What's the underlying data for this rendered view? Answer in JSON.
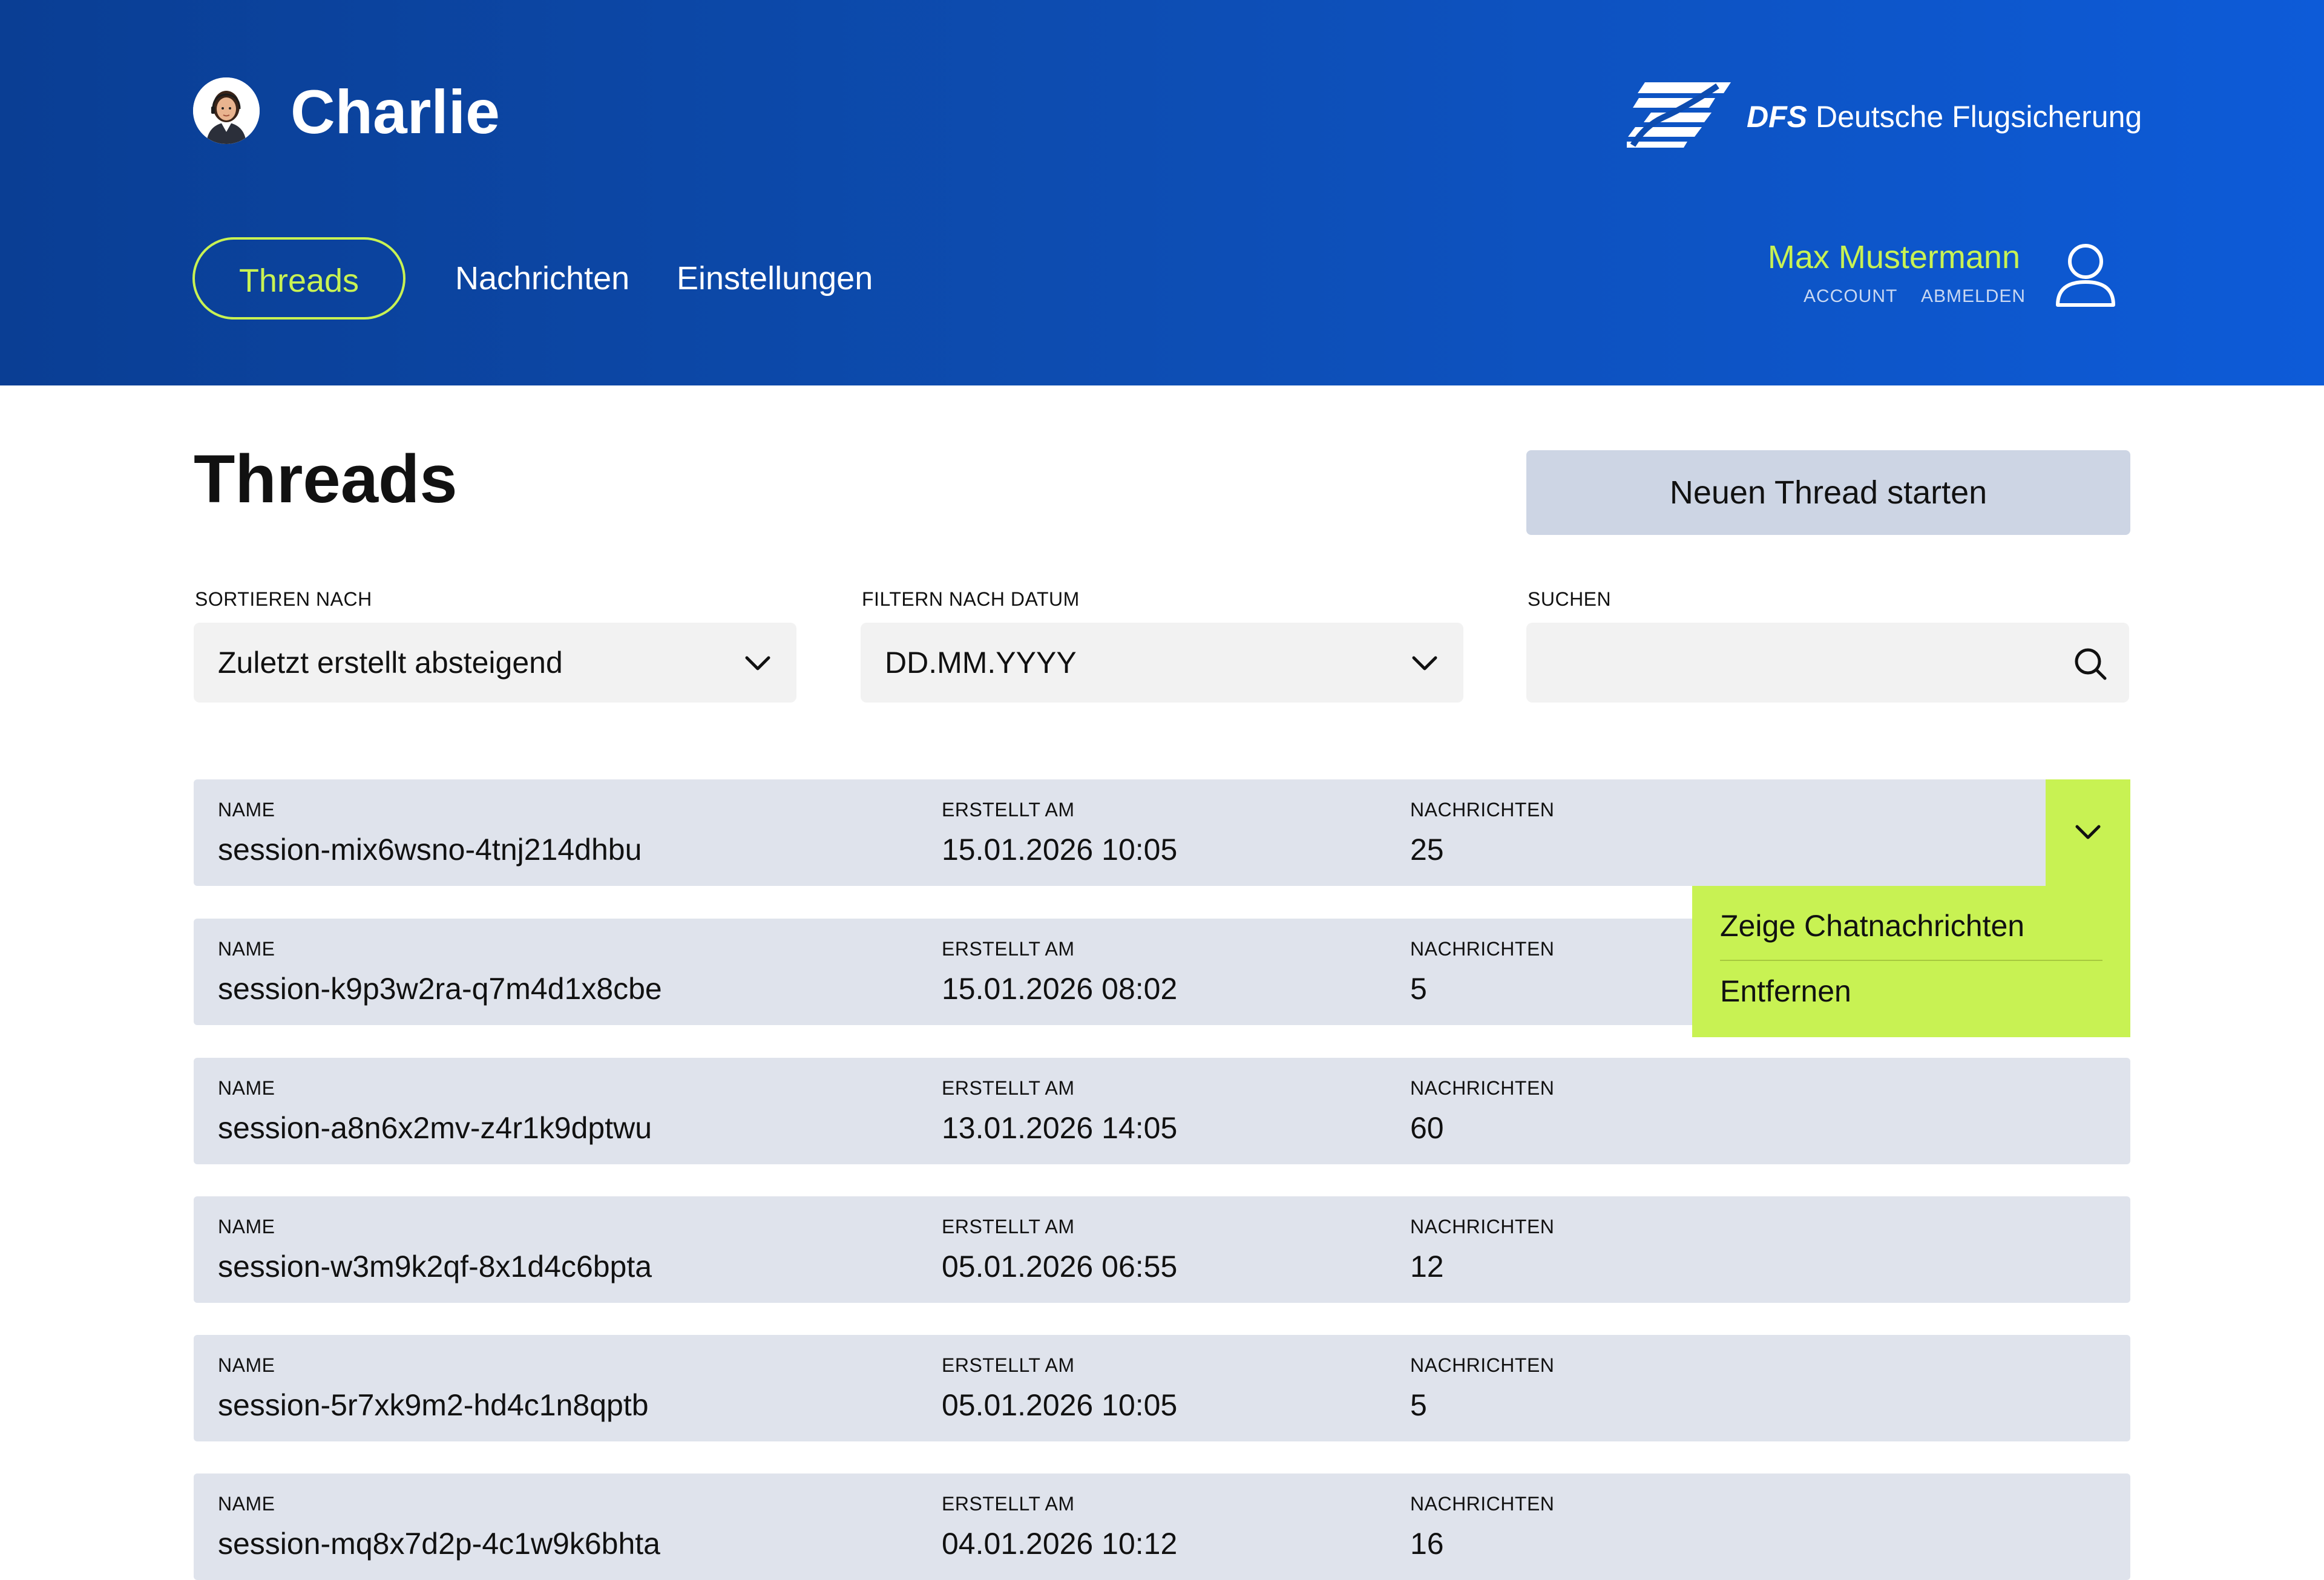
{
  "app": {
    "title": "Charlie"
  },
  "brand": {
    "abbr": "DFS",
    "name": "Deutsche Flugsicherung"
  },
  "nav": {
    "tabs": [
      {
        "label": "Threads"
      },
      {
        "label": "Nachrichten"
      },
      {
        "label": "Einstellungen"
      }
    ]
  },
  "user": {
    "name": "Max Mustermann",
    "account": "ACCOUNT",
    "logout": "ABMELDEN"
  },
  "page": {
    "title": "Threads",
    "new_thread_label": "Neuen Thread starten"
  },
  "controls": {
    "sort": {
      "label": "SORTIEREN NACH",
      "value": "Zuletzt erstellt absteigend"
    },
    "date": {
      "label": "FILTERN NACH DATUM",
      "value": "DD.MM.YYYY"
    },
    "search": {
      "label": "SUCHEN",
      "value": ""
    }
  },
  "table": {
    "columns": {
      "name": "NAME",
      "created": "ERSTELLT AM",
      "messages": "NACHRICHTEN"
    },
    "rows": [
      {
        "name": "session-mix6wsno-4tnj214dhbu",
        "created": "15.01.2026 10:05",
        "messages": "25"
      },
      {
        "name": "session-k9p3w2ra-q7m4d1x8cbe",
        "created": "15.01.2026 08:02",
        "messages": "5"
      },
      {
        "name": "session-a8n6x2mv-z4r1k9dptwu",
        "created": "13.01.2026 14:05",
        "messages": "60"
      },
      {
        "name": "session-w3m9k2qf-8x1d4c6bpta",
        "created": "05.01.2026 06:55",
        "messages": "12"
      },
      {
        "name": "session-5r7xk9m2-hd4c1n8qptb",
        "created": "05.01.2026 10:05",
        "messages": "5"
      },
      {
        "name": "session-mq8x7d2p-4c1w9k6bhta",
        "created": "04.01.2026 10:12",
        "messages": "16"
      }
    ]
  },
  "context_menu": {
    "items": [
      {
        "label": "Zeige Chatnachrichten"
      },
      {
        "label": "Entfernen"
      }
    ]
  },
  "colors": {
    "header_start": "#0a3e94",
    "header_end": "#0d5bd8",
    "accent": "#c8f253",
    "row_bg": "#dfe3ec",
    "button_bg": "#cdd5e4",
    "input_bg": "#f2f2f2"
  }
}
